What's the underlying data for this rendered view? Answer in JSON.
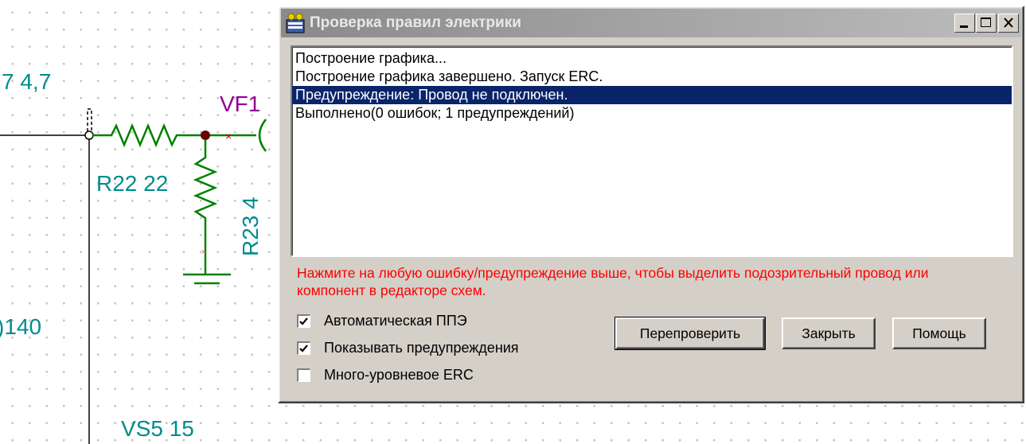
{
  "schematic": {
    "labels": {
      "top_left_value": "7 4,7",
      "vf1": "VF1",
      "r22": "R22 22",
      "r23": "R23 4",
      "left_partial": ")140",
      "vs5": "VS5 15"
    },
    "colors": {
      "wire": "#000000",
      "resistor": "#008000",
      "label_teal": "#008c8c",
      "label_purple": "#900090",
      "junction": "#6b0000",
      "no_connect": "#cc0000"
    }
  },
  "dialog": {
    "title": "Проверка правил электрики",
    "app_icon": "erc-app-icon",
    "titlebar_buttons": {
      "minimize_icon": "minimize-icon",
      "maximize_icon": "maximize-icon",
      "close_icon": "close-icon"
    },
    "log": [
      "Построение графика...",
      "Построение графика завершено. Запуск ERC.",
      "Предупреждение: Провод не подключен.",
      "Выполнено(0 ошибок; 1 предупреждений)"
    ],
    "selected_log_index": 2,
    "hint": "Нажмите на любую ошибку/предупреждение выше, чтобы выделить подозрительный провод или компонент в редакторе схем.",
    "options": [
      {
        "label": "Автоматическая ППЭ",
        "checked": true
      },
      {
        "label": "Показывать предупреждения",
        "checked": true
      },
      {
        "label": "Много-уровневое ERC",
        "checked": false
      }
    ],
    "buttons": {
      "recheck": "Перепроверить",
      "close": "Закрыть",
      "help": "Помощь"
    },
    "colors": {
      "face": "#d4d0c8",
      "selection": "#0a246a",
      "hint_text": "#ff0000"
    }
  }
}
